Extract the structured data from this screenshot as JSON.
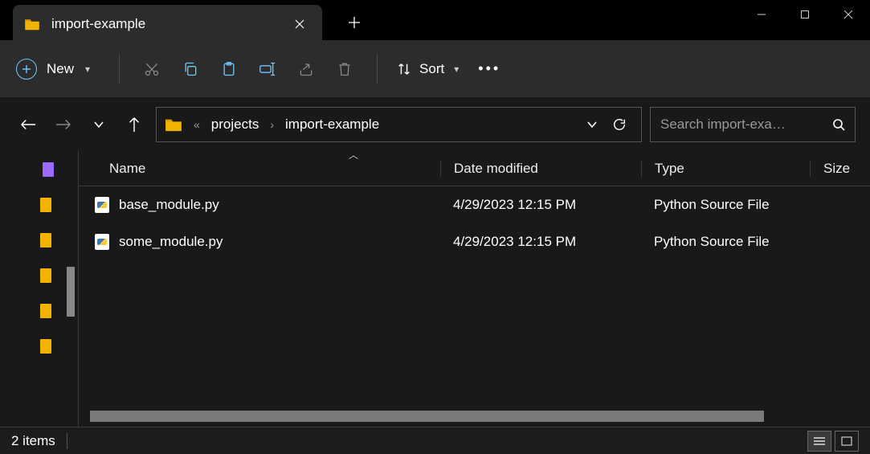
{
  "tab": {
    "title": "import-example"
  },
  "toolbar": {
    "new_label": "New",
    "sort_label": "Sort"
  },
  "breadcrumb": {
    "prefix": "«",
    "parent": "projects",
    "current": "import-example"
  },
  "search": {
    "placeholder": "Search import-exa…"
  },
  "columns": {
    "name": "Name",
    "date": "Date modified",
    "type": "Type",
    "size": "Size"
  },
  "files": [
    {
      "name": "base_module.py",
      "date": "4/29/2023 12:15 PM",
      "type": "Python Source File"
    },
    {
      "name": "some_module.py",
      "date": "4/29/2023 12:15 PM",
      "type": "Python Source File"
    }
  ],
  "status": {
    "count": "2 items"
  }
}
